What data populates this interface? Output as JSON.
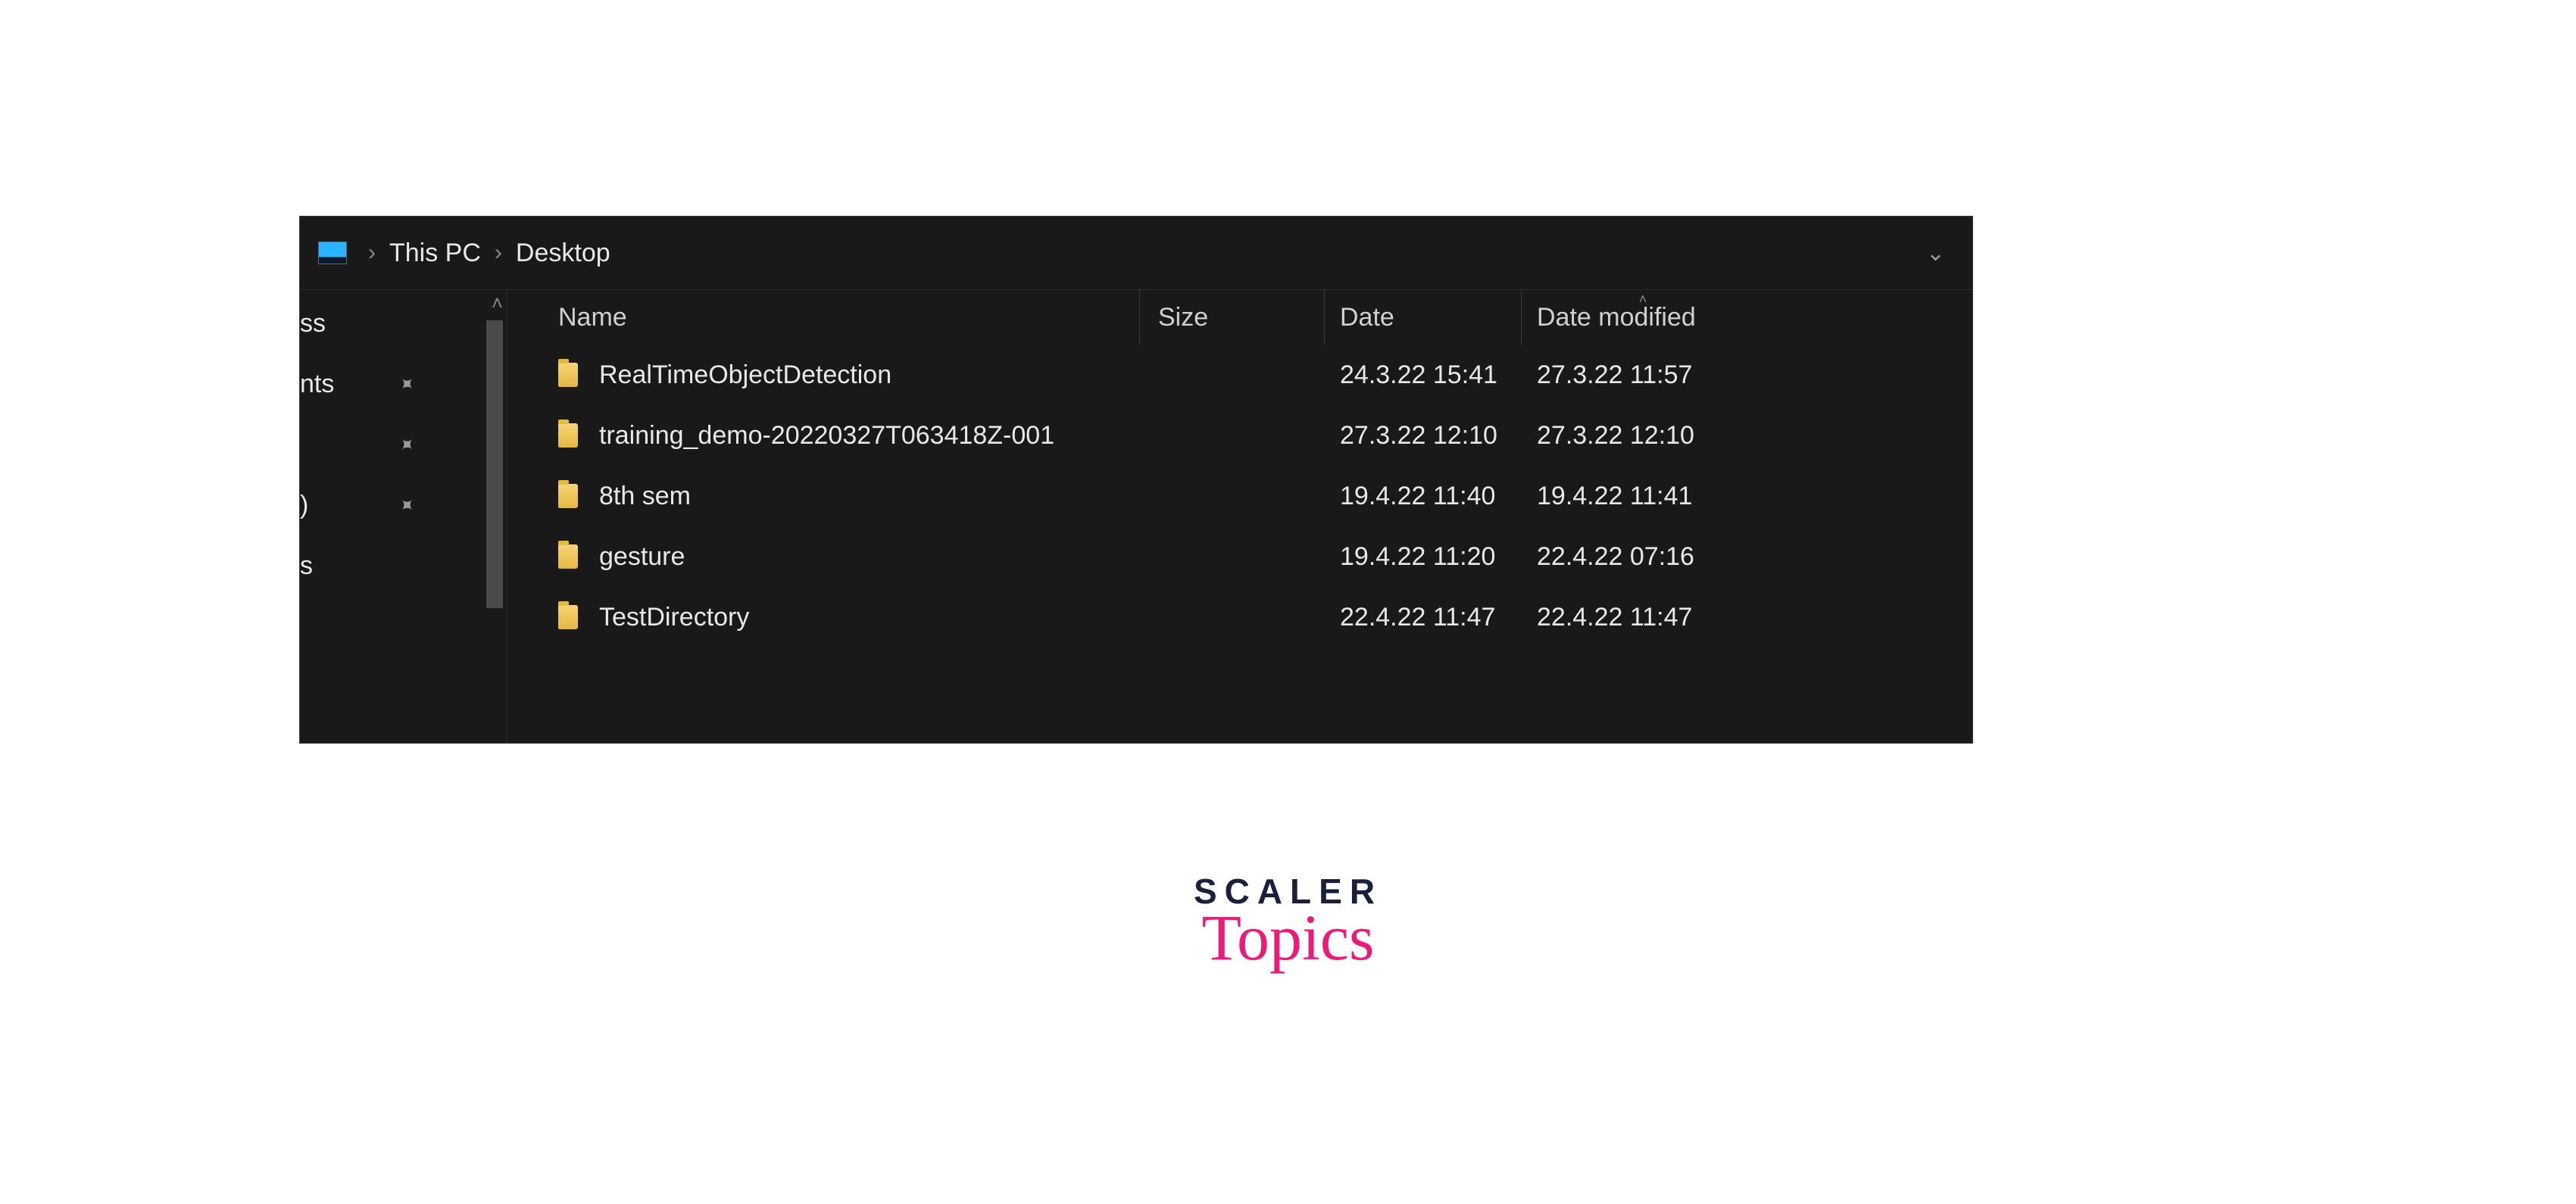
{
  "breadcrumb": {
    "root": "This PC",
    "current": "Desktop"
  },
  "sidebar": {
    "items": [
      {
        "label": "ss",
        "pinned": false
      },
      {
        "label": "nts",
        "pinned": true
      },
      {
        "label": "",
        "pinned": true
      },
      {
        "label": ")",
        "pinned": true
      },
      {
        "label": "s",
        "pinned": false
      }
    ]
  },
  "columns": {
    "name": "Name",
    "size": "Size",
    "date": "Date",
    "modified": "Date modified"
  },
  "files": [
    {
      "name": "RealTimeObjectDetection",
      "size": "",
      "date": "24.3.22 15:41",
      "modified": "27.3.22 11:57"
    },
    {
      "name": "training_demo-20220327T063418Z-001",
      "size": "",
      "date": "27.3.22 12:10",
      "modified": "27.3.22 12:10"
    },
    {
      "name": "8th sem",
      "size": "",
      "date": "19.4.22 11:40",
      "modified": "19.4.22 11:41"
    },
    {
      "name": "gesture",
      "size": "",
      "date": "19.4.22 11:20",
      "modified": "22.4.22 07:16"
    },
    {
      "name": "TestDirectory",
      "size": "",
      "date": "22.4.22 11:47",
      "modified": "22.4.22 11:47"
    }
  ],
  "watermark": {
    "line1": "SCALER",
    "line2": "Topics"
  }
}
